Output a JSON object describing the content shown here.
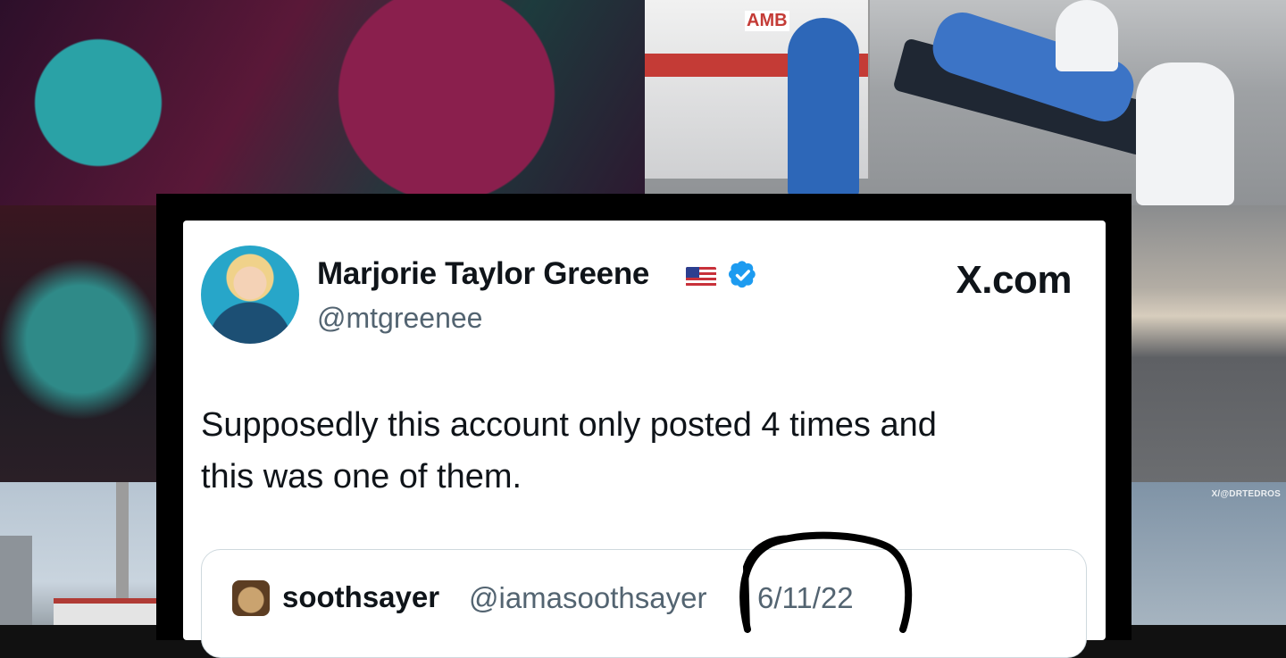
{
  "tweet": {
    "author_name": "Marjorie Taylor Greene",
    "author_handle": "@mtgreenee",
    "site": "X.com",
    "text_line1": "Supposedly this account only posted 4 times and",
    "text_line2": "this was one of them.",
    "flag_icon": "us-flag-icon",
    "verified_icon": "verified-badge-icon"
  },
  "quoted_tweet": {
    "name": "soothsayer",
    "handle": "@iamasoothsayer",
    "date": "6/11/22"
  },
  "background": {
    "watermark": "X/@DRTEDROS",
    "ambulance_sign": "AMB"
  },
  "colors": {
    "text_primary": "#0f1419",
    "text_secondary": "#536471",
    "verified_blue": "#1d9bf0",
    "annotation_ink": "#000000"
  }
}
